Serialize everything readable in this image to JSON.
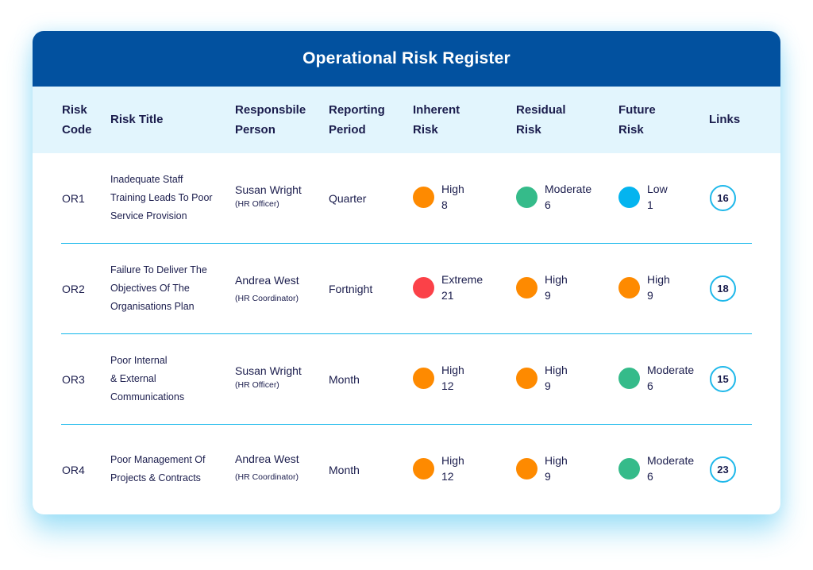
{
  "title": "Operational Risk Register",
  "colors": {
    "header_bg": "#02519f",
    "table_header_bg": "#e2f5fd",
    "divider": "#10b6ea",
    "text": "#1b1d4d",
    "risk_levels": {
      "Extreme": "#fb4148",
      "High": "#fe8a00",
      "Moderate": "#35bb8a",
      "Low": "#04b4ef"
    }
  },
  "columns": {
    "risk_code": [
      "Risk",
      "Code"
    ],
    "risk_title": [
      "Risk Title"
    ],
    "responsible_person": [
      "Responsbile",
      "Person"
    ],
    "reporting_period": [
      "Reporting",
      "Period"
    ],
    "inherent_risk": [
      "Inherent",
      "Risk"
    ],
    "residual_risk": [
      "Residual",
      "Risk"
    ],
    "future_risk": [
      "Future",
      "Risk"
    ],
    "links": [
      "Links"
    ]
  },
  "rows": [
    {
      "code": "OR1",
      "title_lines": [
        "Inadequate Staff",
        "Training Leads To Poor",
        "Service Provision"
      ],
      "person": "Susan Wright",
      "role": "(HR Officer)",
      "period": "Quarter",
      "inherent": {
        "level": "High",
        "score": "8"
      },
      "residual": {
        "level": "Moderate",
        "score": "6"
      },
      "future": {
        "level": "Low",
        "score": "1"
      },
      "links": "16"
    },
    {
      "code": "OR2",
      "title_lines": [
        "Failure To Deliver The",
        "Objectives Of The",
        "Organisations Plan"
      ],
      "person": "Andrea West",
      "role": "(HR Coordinator)",
      "period": "Fortnight",
      "inherent": {
        "level": "Extreme",
        "score": "21"
      },
      "residual": {
        "level": "High",
        "score": "9"
      },
      "future": {
        "level": "High",
        "score": "9"
      },
      "links": "18"
    },
    {
      "code": "OR3",
      "title_lines": [
        "Poor Internal",
        "& External",
        "Communications"
      ],
      "person": "Susan Wright",
      "role": "(HR Officer)",
      "period": "Month",
      "inherent": {
        "level": "High",
        "score": "12"
      },
      "residual": {
        "level": "High",
        "score": "9"
      },
      "future": {
        "level": "Moderate",
        "score": "6"
      },
      "links": "15"
    },
    {
      "code": "OR4",
      "title_lines": [
        "Poor Management Of",
        "Projects & Contracts"
      ],
      "person": "Andrea West",
      "role": "(HR Coordinator)",
      "period": "Month",
      "inherent": {
        "level": "High",
        "score": "12"
      },
      "residual": {
        "level": "High",
        "score": "9"
      },
      "future": {
        "level": "Moderate",
        "score": "6"
      },
      "links": "23"
    }
  ]
}
